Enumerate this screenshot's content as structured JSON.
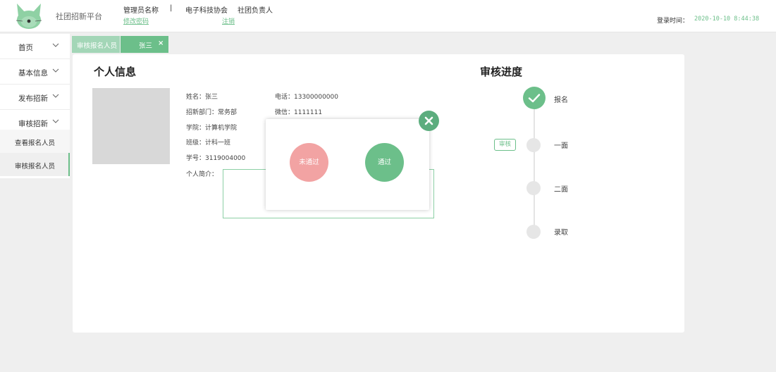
{
  "header": {
    "brand": "社团招新平台",
    "admin_name": "管理员名称",
    "change_password": "修改密码",
    "separator": "|",
    "club_name": "电子科技协会",
    "club_role": "社团负责人",
    "logout": "注销",
    "login_time_label": "登录时间：",
    "login_time": "2020-10-10 8:44:38"
  },
  "sidebar": {
    "items": [
      {
        "label": "首页"
      },
      {
        "label": "基本信息"
      },
      {
        "label": "发布招新"
      },
      {
        "label": "审核招新"
      }
    ],
    "sub_items": [
      {
        "label": "查看报名人员",
        "active": false
      },
      {
        "label": "审核报名人员",
        "active": true
      }
    ]
  },
  "tabs": [
    {
      "label": "审核报名人员"
    },
    {
      "label": "张三",
      "close": "×"
    }
  ],
  "profile": {
    "title": "个人信息",
    "name": "姓名：张三",
    "department": "招新部门：常务部",
    "college": "学院：计算机学院",
    "class": "班级：计科一班",
    "student_id": "学号：3119004000",
    "intro_label": "个人简介：",
    "phone": "电话：13300000000",
    "wechat": "微信：1111111"
  },
  "progress": {
    "title": "审核进度",
    "steps": [
      {
        "label": "报名",
        "done": true
      },
      {
        "label": "一面",
        "done": false
      },
      {
        "label": "二面",
        "done": false
      },
      {
        "label": "录取",
        "done": false
      }
    ],
    "action_badge": "审核"
  },
  "modal": {
    "reject_label": "未通过",
    "pass_label": "通过"
  },
  "colors": {
    "accent": "#6cbf8a",
    "reject": "#f2a3a3",
    "background": "#efefef"
  },
  "icons": {
    "logo": "cat-logo-icon",
    "chevron": "chevron-down-icon",
    "check": "check-icon",
    "close": "close-icon"
  }
}
